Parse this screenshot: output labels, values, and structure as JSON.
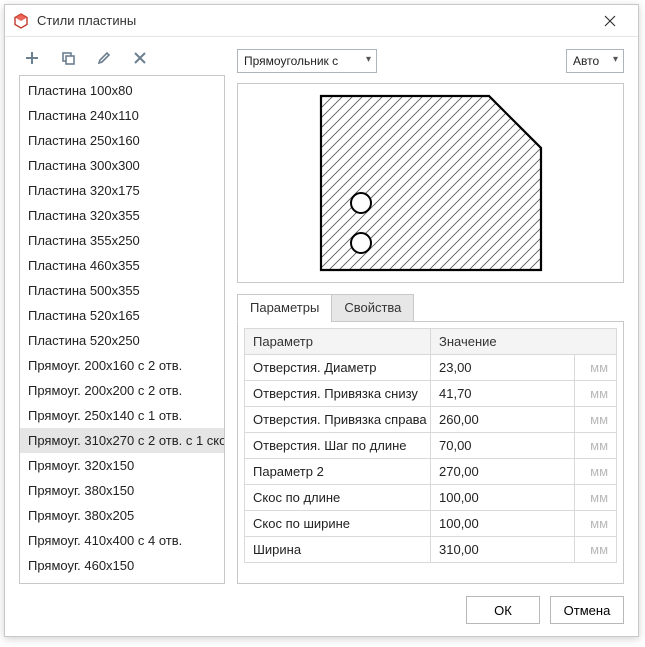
{
  "window": {
    "title": "Стили пластины"
  },
  "toolbar": {
    "add": "+",
    "copy": "⧉",
    "edit": "✎",
    "delete": "✕"
  },
  "shape_select": {
    "value": "Прямоугольник с"
  },
  "auto_select": {
    "value": "Авто"
  },
  "list": {
    "items": [
      "Пластина 100x80",
      "Пластина 240x110",
      "Пластина 250x160",
      "Пластина 300x300",
      "Пластина 320x175",
      "Пластина 320x355",
      "Пластина 355x250",
      "Пластина 460x355",
      "Пластина 500x355",
      "Пластина 520x165",
      "Пластина 520x250",
      "Прямоуг. 200x160 c 2 отв.",
      "Прямоуг. 200x200 c 2 отв.",
      "Прямоуг. 250x140 с 1 отв.",
      "Прямоуг. 310x270 с 2 отв. с 1 ско",
      "Прямоуг. 320x150",
      "Прямоуг. 380x150",
      "Прямоуг. 380x205",
      "Прямоуг. 410x400 с 4 отв.",
      "Прямоуг. 460x150"
    ],
    "selected_index": 14
  },
  "tabs": {
    "params": "Параметры",
    "props": "Свойства"
  },
  "params_table": {
    "head_param": "Параметр",
    "head_value": "Значение",
    "unit": "мм",
    "rows": [
      {
        "name": "Отверстия. Диаметр",
        "value": "23,00"
      },
      {
        "name": "Отверстия. Привязка снизу",
        "value": "41,70"
      },
      {
        "name": "Отверстия. Привязка справа",
        "value": "260,00"
      },
      {
        "name": "Отверстия. Шаг по длине",
        "value": "70,00"
      },
      {
        "name": "Параметр 2",
        "value": "270,00"
      },
      {
        "name": "Скос по длине",
        "value": "100,00"
      },
      {
        "name": "Скос по ширине",
        "value": "100,00"
      },
      {
        "name": "Ширина",
        "value": "310,00"
      }
    ]
  },
  "buttons": {
    "ok": "ОК",
    "cancel": "Отмена"
  }
}
